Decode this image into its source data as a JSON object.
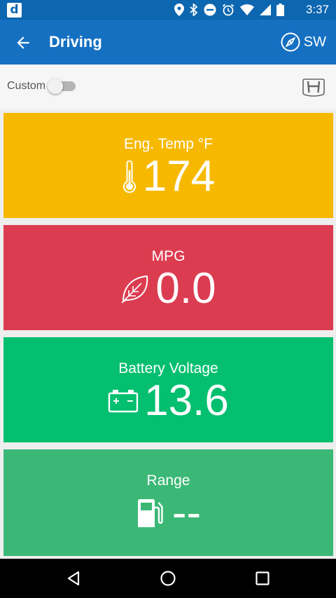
{
  "status_bar": {
    "app_badge": "d",
    "time": "3:37"
  },
  "app_bar": {
    "title": "Driving",
    "compass_heading": "SW"
  },
  "toolbar": {
    "custom_label": "Custom",
    "custom_toggle_on": false
  },
  "cards": [
    {
      "label": "Eng. Temp °F",
      "value": "174",
      "color": "#f6b900",
      "icon": "thermometer-icon"
    },
    {
      "label": "MPG",
      "value": "0.0",
      "color": "#dc3c50",
      "icon": "leaf-icon"
    },
    {
      "label": "Battery Voltage",
      "value": "13.6",
      "color": "#03bf6f",
      "icon": "battery-icon"
    },
    {
      "label": "Range",
      "value": "--",
      "color": "#3bb876",
      "icon": "fuel-pump-icon"
    }
  ],
  "colors": {
    "status_bar": "#0d66b0",
    "app_bar": "#1570c2"
  }
}
